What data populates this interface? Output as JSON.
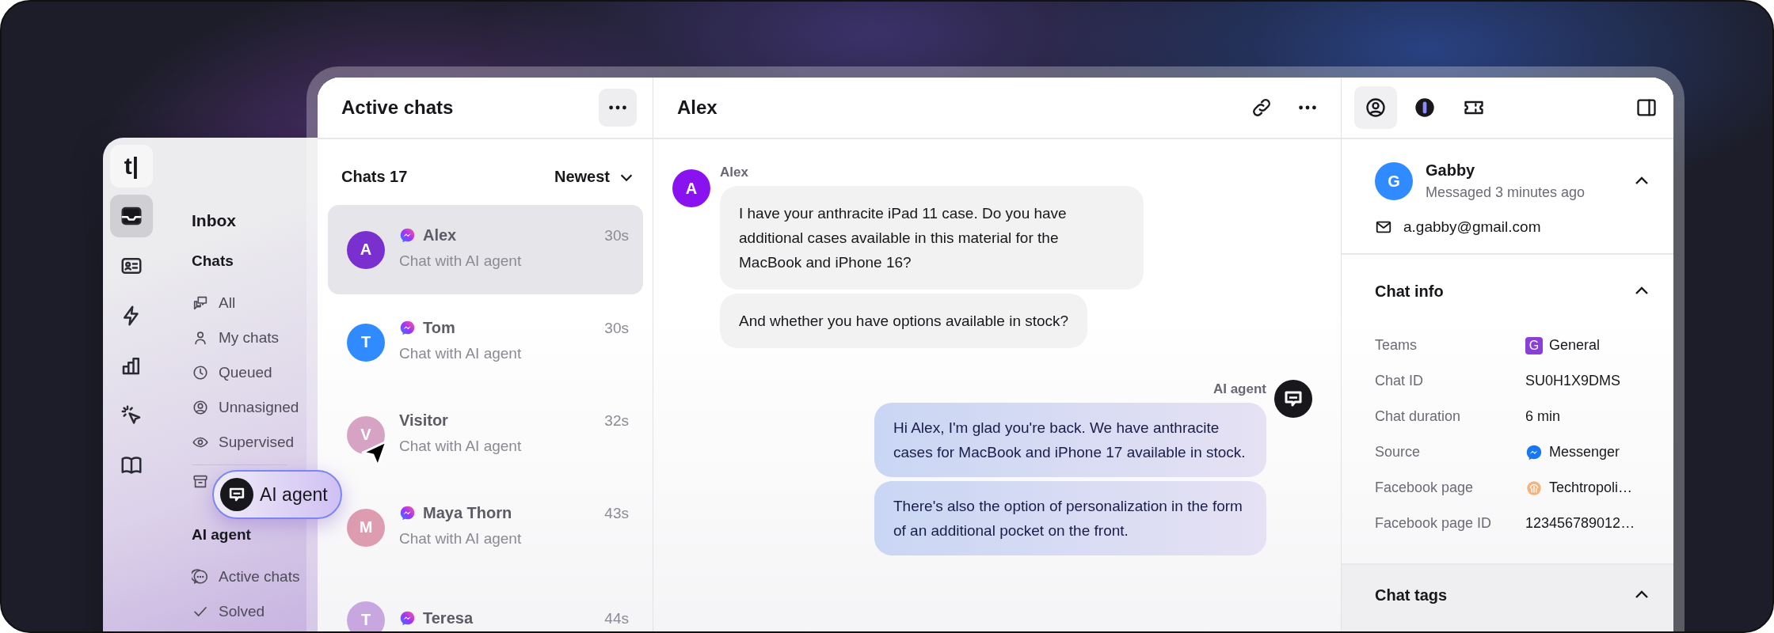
{
  "sidebar": {
    "logo": "t|",
    "rail": [
      {
        "selected": true
      },
      {
        "selected": false
      },
      {
        "selected": false
      },
      {
        "selected": false
      },
      {
        "selected": false
      },
      {
        "selected": false
      }
    ],
    "title": "Inbox",
    "sections": [
      {
        "heading": "Chats",
        "items": [
          {
            "label": "All"
          },
          {
            "label": "My chats"
          },
          {
            "label": "Queued"
          },
          {
            "label": "Unnasigned"
          },
          {
            "label": "Supervised"
          }
        ]
      },
      {
        "heading": "AI agent",
        "items": [
          {
            "label": "Active chats"
          },
          {
            "label": "Solved"
          }
        ]
      }
    ]
  },
  "floating_chip": {
    "label": "AI agent"
  },
  "chat_list": {
    "title": "Active chats",
    "count": "Chats 17",
    "sort": "Newest",
    "rows": [
      {
        "avatar": "A",
        "color": "#7a2fcf",
        "name": "Alex",
        "messenger": true,
        "time": "30s",
        "preview": "Chat with AI agent",
        "selected": true
      },
      {
        "avatar": "T",
        "color": "#2f8bff",
        "name": "Tom",
        "messenger": true,
        "time": "30s",
        "preview": "Chat with AI agent",
        "selected": false
      },
      {
        "avatar": "V",
        "color": "#d6a3c4",
        "name": "Visitor",
        "messenger": false,
        "time": "32s",
        "preview": "Chat with AI agent",
        "selected": false
      },
      {
        "avatar": "M",
        "color": "#dd9cb0",
        "name": "Maya Thorn",
        "messenger": true,
        "time": "43s",
        "preview": "Chat with AI agent",
        "selected": false
      },
      {
        "avatar": "T",
        "color": "#c8a6e0",
        "name": "Teresa",
        "messenger": true,
        "time": "44s",
        "selected": false
      }
    ]
  },
  "conversation": {
    "title": "Alex",
    "groups": [
      {
        "kind": "customer",
        "sender": "Alex",
        "avatar": "A",
        "color": "#8a12f0",
        "bubbles": [
          "I have your anthracite iPad 11 case. Do you have additional cases available in this material for the MacBook and iPhone 16?",
          "And whether you have options available in stock?"
        ]
      },
      {
        "kind": "agent",
        "sender": "AI agent",
        "bubbles": [
          "Hi Alex, I'm glad you're back. We have anthracite cases for MacBook and iPhone 17 available in stock.",
          "There's also the option of personalization in the form of an additional pocket on the front."
        ]
      }
    ]
  },
  "details": {
    "tabs": [
      {
        "selected": true
      },
      {
        "selected": false
      },
      {
        "selected": false
      }
    ],
    "contact": {
      "avatar": "G",
      "name": "Gabby",
      "subtitle": "Messaged 3 minutes ago",
      "email": "a.gabby@gmail.com",
      "expanded": true
    },
    "chat_info": {
      "title": "Chat info",
      "expanded": true,
      "rows": [
        {
          "label": "Teams",
          "kind": "team",
          "badge": "G",
          "value": "General"
        },
        {
          "label": "Chat ID",
          "kind": "text",
          "value": "SU0H1X9DMS"
        },
        {
          "label": "Chat duration",
          "kind": "text",
          "value": "6 min"
        },
        {
          "label": "Source",
          "kind": "messenger",
          "value": "Messenger"
        },
        {
          "label": "Facebook page",
          "kind": "page",
          "value": "Techtropoli…"
        },
        {
          "label": "Facebook page ID",
          "kind": "text",
          "value": "123456789012…"
        }
      ]
    },
    "chat_tags": {
      "title": "Chat tags",
      "expanded": true
    }
  }
}
